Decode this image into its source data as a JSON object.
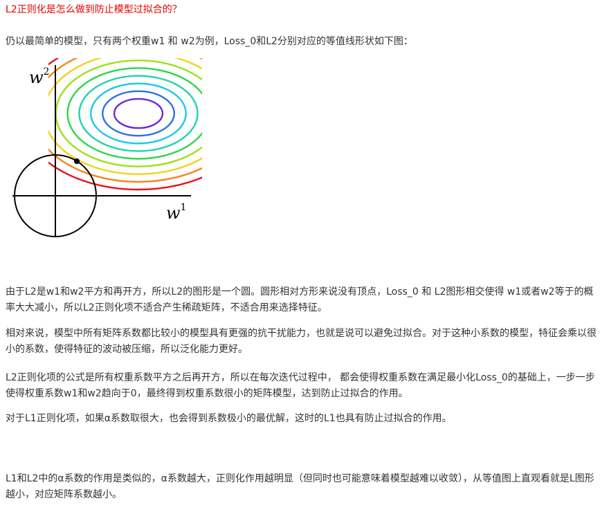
{
  "article": {
    "title": "L2正则化是怎么做到防止模型过拟合的？",
    "intro": "仍以最简单的模型，只有两个权重w1 和 w2为例，Loss_0和L2分别对应的等值线形状如下图：",
    "figure": {
      "axis_y_label": "w",
      "axis_y_sup": "2",
      "axis_x_label": "w",
      "axis_x_sup": "1",
      "contour_colors": [
        "#e8131b",
        "#f7821e",
        "#f2d21a",
        "#9ee015",
        "#2dd64a",
        "#1fd4a8",
        "#18c9ea",
        "#2b6fe6",
        "#6a2ad8"
      ]
    },
    "paragraphs": [
      "由于L2是w1和w2平方和再开方，所以L2的图形是一个圆。圆形相对方形来说没有顶点，Loss_0 和 L2图形相交使得 w1或者w2等于的概率大大减小，所以L2正则化项不适合产生稀疏矩阵，不适合用来选择特征。",
      "相对来说，模型中所有矩阵系数都比较小的模型具有更强的抗干扰能力，也就是说可以避免过拟合。对于这种小系数的模型，特征会乘以很小的系数，使得特征的波动被压缩，所以泛化能力更好。",
      "L2正则化项的公式是所有权重系数平方之后再开方，所以在每次迭代过程中， 都会使得权重系数在满足最小化Loss_0的基础上，一步一步使得权重系数w1和w2趋向于0，最终得到权重系数很小的矩阵模型，达到防止过拟合的作用。",
      "对于L1正则化项，如果α系数取很大，也会得到系数极小的最优解，这时的L1也具有防止过拟合的作用。",
      "L1和L2中的α系数的作用是类似的，α系数越大，正则化作用越明显（但同时也可能意味着模型越难以收敛），从等值图上直观看就是L图形越小，对应矩阵系数越小。"
    ]
  }
}
